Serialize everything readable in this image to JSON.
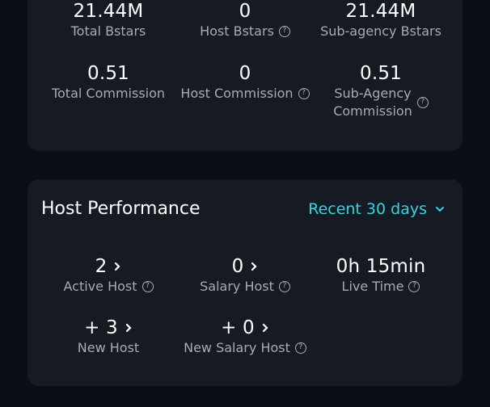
{
  "stats": {
    "total_bstars": {
      "value": "21.44M",
      "label": "Total Bstars"
    },
    "host_bstars": {
      "value": "0",
      "label": "Host Bstars"
    },
    "subagency_bstars": {
      "value": "21.44M",
      "label": "Sub-agency Bstars"
    },
    "total_commission": {
      "value": "0.51",
      "label": "Total Commission"
    },
    "host_commission": {
      "value": "0",
      "label": "Host Commission"
    },
    "subagency_commission": {
      "value": "0.51",
      "label_line1": "Sub-Agency",
      "label_line2": "Commission"
    }
  },
  "performance": {
    "title": "Host Performance",
    "range": "Recent 30 days",
    "active_host": {
      "value": "2",
      "label": "Active Host"
    },
    "salary_host": {
      "value": "0",
      "label": "Salary Host"
    },
    "live_time": {
      "value": "0h 15min",
      "label": "Live Time"
    },
    "new_host": {
      "value": "+ 3",
      "label": "New Host"
    },
    "new_salary_host": {
      "value": "+ 0",
      "label": "New Salary Host"
    }
  },
  "colors": {
    "accent": "#2fd6e6",
    "card": "#161a22",
    "background": "#0b0e14"
  },
  "icons": {
    "help": "question-circle-icon",
    "chevron": "chevron-right-icon",
    "dropdown": "chevron-down-icon"
  }
}
